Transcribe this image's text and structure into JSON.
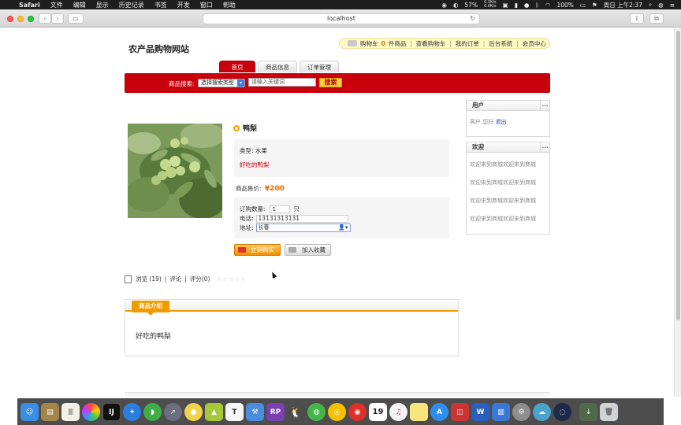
{
  "menubar": {
    "app": "Safari",
    "items": [
      "文件",
      "编辑",
      "显示",
      "历史记录",
      "书签",
      "开发",
      "窗口",
      "帮助"
    ],
    "battery": "57%",
    "net_up": "0.1K/s",
    "net_down": "0.0K/s",
    "battery_full": "100%",
    "clock": "周日 上午2:37"
  },
  "browser": {
    "url": "localhost"
  },
  "site": {
    "title": "农产品购物网站",
    "topnav": {
      "cart_prefix": "购物车",
      "cart_count": "0",
      "cart_suffix": "件商品",
      "links": [
        "查看购物车",
        "我的订单",
        "后台系统",
        "会员中心"
      ]
    },
    "tabs": [
      "首页",
      "商品信息",
      "订单管理"
    ],
    "search": {
      "label": "商品搜索:",
      "type_select": "选择搜索类型",
      "keyword_placeholder": "请输入关键词",
      "button": "搜索"
    }
  },
  "product": {
    "name": "鸭梨",
    "category_label": "类型:",
    "category": "水果",
    "tagline": "好吃的鸭梨",
    "price_label": "商品售价:",
    "price": "¥200",
    "qty_label": "订购数量:",
    "qty": "1",
    "qty_unit": "只",
    "phone_label": "电话:",
    "phone": "13131313131",
    "addr_label": "地址:",
    "addr": "长春",
    "buy_button": "立刻购买",
    "fav_button": "加入收藏",
    "stats": {
      "views": "浏览 (19)",
      "comments": "评论",
      "rating": "评分(0)",
      "sep": "|",
      "stars": "☆☆☆☆☆"
    },
    "desc_tab": "商品介绍",
    "desc_text": "好吃的鸭梨"
  },
  "sidebar": {
    "user": {
      "title": "用户",
      "more": "...",
      "greeting": "客户,您好",
      "logout": "退出"
    },
    "welcome": {
      "title": "欢迎",
      "more": "...",
      "lines": [
        "欢迎来到商城欢迎来到商城",
        "欢迎来到商城欢迎来到商城",
        "欢迎来到商城欢迎来到商城",
        "欢迎来到商城欢迎来到商城"
      ]
    }
  },
  "colors": {
    "brand_red": "#c8000b",
    "accent_orange": "#f39a00",
    "price_orange": "#e46c00",
    "topnav_yellow": "#fff9c4"
  },
  "dock": {
    "icons": [
      "finder-icon",
      "preview-icon",
      "notes-icon",
      "photos-icon",
      "intellij-icon",
      "safari-icon",
      "android-icon",
      "launchpad-icon",
      "chick-icon",
      "android-studio-icon",
      "textedit-icon",
      "xcode-icon",
      "rp-icon",
      "qq-icon",
      "wechat-icon",
      "chrome-like-icon",
      "netease-music-icon",
      "calendar-icon",
      "itunes-icon",
      "stickies-icon",
      "appstore-icon",
      "screen-icon",
      "word-icon",
      "keynote-icon",
      "settings-icon",
      "cloud-icon",
      "network-icon",
      "downloads-icon",
      "trash-icon"
    ],
    "calendar_day": "19",
    "rp_label": "RP",
    "word_label": "W",
    "textedit_label": "T"
  }
}
